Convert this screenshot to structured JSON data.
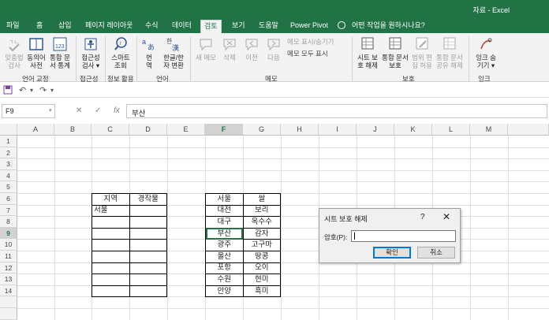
{
  "title": "자료  -  Excel",
  "tabs": [
    "파일",
    "홈",
    "삽입",
    "페이지 레이아웃",
    "수식",
    "데이터",
    "검토",
    "보기",
    "도움말",
    "Power Pivot"
  ],
  "active_tab": "검토",
  "tell_me": "어떤 작업을 원하시나요?",
  "ribbon": {
    "groups": {
      "proofing": "언어 교정",
      "accessibility": "접근성",
      "insights": "정보 활용",
      "language": "언어",
      "comments": "메모",
      "protect": "보호",
      "ink": "잉크"
    },
    "buttons": {
      "spelling": [
        "맞춤법",
        "검사"
      ],
      "thesaurus": [
        "동의어",
        "사전"
      ],
      "stats": [
        "통합 문",
        "서 통계"
      ],
      "access_check": [
        "접근성",
        "검사 ▾"
      ],
      "smart_lookup": [
        "스마트",
        "조회"
      ],
      "translate": [
        "번",
        "역"
      ],
      "han_convert": [
        "한글/한",
        "자 변환"
      ],
      "new_comment": "새 메모",
      "delete": "삭제",
      "prev": "이전",
      "next": "다음",
      "show_hide": "메모 표시/숨기기",
      "show_all": "메모 모두 표시",
      "unprotect_sheet": [
        "시트 보",
        "호 해제"
      ],
      "protect_book": [
        "통합 문서",
        "보호"
      ],
      "allow_ranges": [
        "범위 편",
        "집 허용"
      ],
      "share_book": [
        "통합 문서",
        "공유 해제"
      ],
      "ink": [
        "잉크 숨",
        "기기 ▾"
      ]
    }
  },
  "name_box": "F9",
  "formula_value": "부산",
  "columns": [
    "A",
    "B",
    "C",
    "D",
    "E",
    "F",
    "G",
    "H",
    "I",
    "J",
    "K",
    "L",
    "M"
  ],
  "rows": [
    "1",
    "2",
    "3",
    "4",
    "5",
    "6",
    "7",
    "8",
    "9",
    "10",
    "11",
    "12",
    "13",
    "14"
  ],
  "table1": {
    "headers": [
      "지역",
      "경작물"
    ],
    "first_cell": "서울"
  },
  "table2": {
    "rows": [
      [
        "서울",
        "쌀"
      ],
      [
        "대전",
        "보리"
      ],
      [
        "대구",
        "옥수수"
      ],
      [
        "부산",
        "감자"
      ],
      [
        "광주",
        "고구마"
      ],
      [
        "울산",
        "땅콩"
      ],
      [
        "포항",
        "오이"
      ],
      [
        "수원",
        "현미"
      ],
      [
        "안양",
        "흑미"
      ]
    ]
  },
  "dialog": {
    "title": "시트 보호 해제",
    "help": "?",
    "close": "✕",
    "password_label": "암호(P):",
    "ok": "확인",
    "cancel": "취소"
  }
}
